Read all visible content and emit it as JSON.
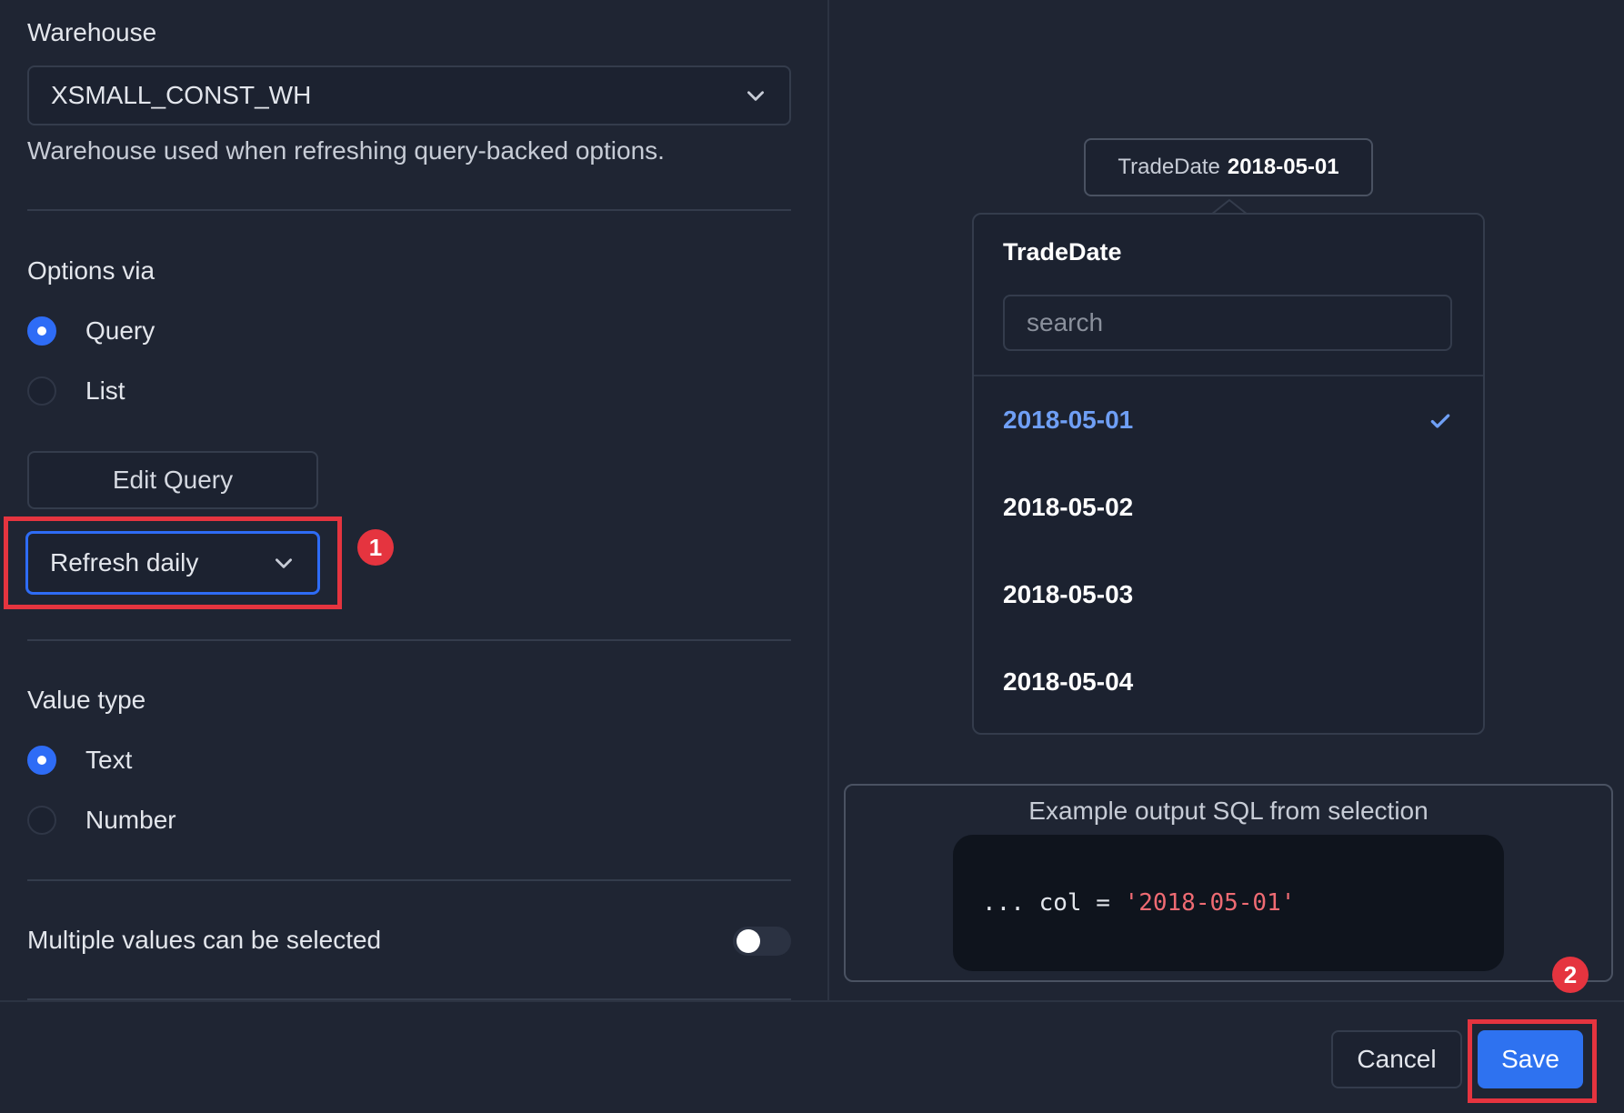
{
  "warehouse": {
    "label": "Warehouse",
    "selected": "XSMALL_CONST_WH",
    "help": "Warehouse used when refreshing query-backed options."
  },
  "options_via": {
    "label": "Options via",
    "items": [
      {
        "label": "Query",
        "checked": true
      },
      {
        "label": "List",
        "checked": false
      }
    ],
    "edit_query_label": "Edit Query",
    "refresh": {
      "selected": "Refresh daily"
    }
  },
  "value_type": {
    "label": "Value type",
    "items": [
      {
        "label": "Text",
        "checked": true
      },
      {
        "label": "Number",
        "checked": false
      }
    ]
  },
  "multi_select": {
    "label": "Multiple values can be selected",
    "enabled": false
  },
  "annotations": {
    "badge_1": "1",
    "badge_2": "2",
    "highlight_color": "#e5343f"
  },
  "preview": {
    "chip": {
      "name": "TradeDate",
      "value": "2018-05-01"
    },
    "popover": {
      "title": "TradeDate",
      "search_placeholder": "search",
      "options": [
        "2018-05-01",
        "2018-05-02",
        "2018-05-03",
        "2018-05-04"
      ],
      "selected": "2018-05-01"
    },
    "sql": {
      "caption": "Example output SQL from selection",
      "prefix": "... col = ",
      "literal": "'2018-05-01'"
    }
  },
  "footer": {
    "cancel_label": "Cancel",
    "save_label": "Save"
  },
  "colors": {
    "accent": "#2e72f0",
    "background": "#1f2533",
    "selected_option": "#6f9ff5"
  }
}
